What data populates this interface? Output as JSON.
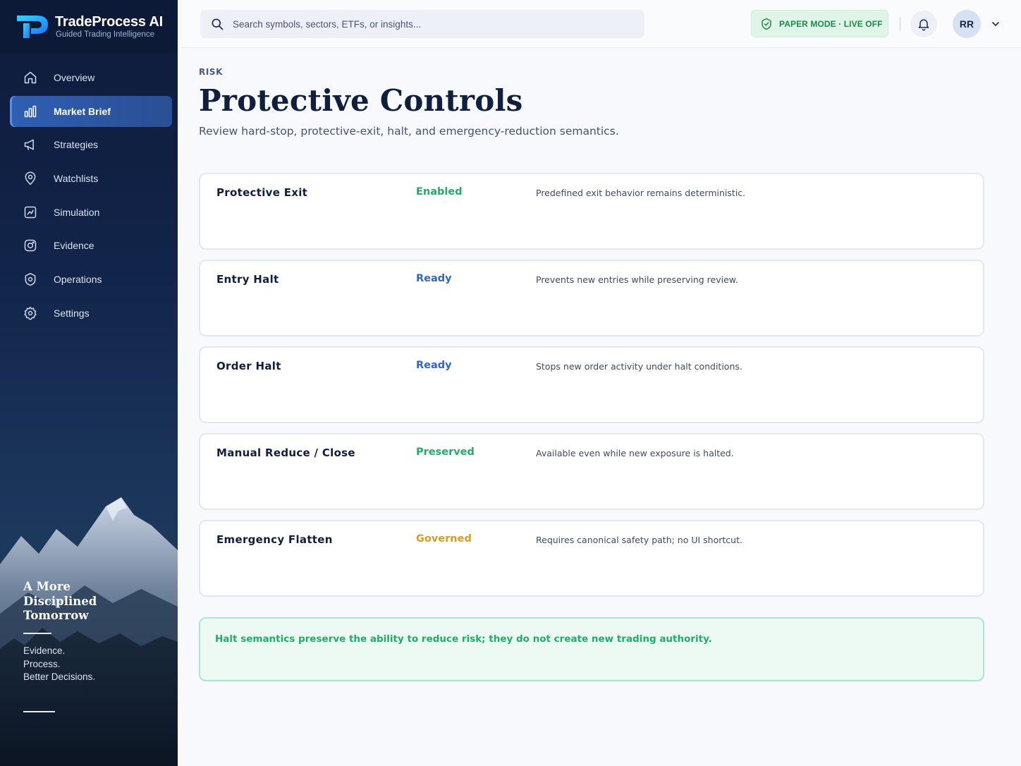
{
  "brand": {
    "name": "TradeProcess AI",
    "tagline": "Guided Trading Intelligence"
  },
  "sidebar": {
    "items": [
      {
        "label": "Overview",
        "icon": "home-icon",
        "active": false
      },
      {
        "label": "Market Brief",
        "icon": "bar-chart-icon",
        "active": true
      },
      {
        "label": "Strategies",
        "icon": "megaphone-icon",
        "active": false
      },
      {
        "label": "Watchlists",
        "icon": "map-pin-icon",
        "active": false
      },
      {
        "label": "Simulation",
        "icon": "chart-box-icon",
        "active": false
      },
      {
        "label": "Evidence",
        "icon": "camera-icon",
        "active": false
      },
      {
        "label": "Operations",
        "icon": "shield-target-icon",
        "active": false
      },
      {
        "label": "Settings",
        "icon": "gear-icon",
        "active": false
      }
    ],
    "motto": {
      "line1": "A More",
      "line2": "Disciplined",
      "line3": "Tomorrow",
      "sub1": "Evidence.",
      "sub2": "Process.",
      "sub3": "Better Decisions."
    }
  },
  "topbar": {
    "search_placeholder": "Search symbols, sectors, ETFs, or insights...",
    "mode_badge": "PAPER MODE · LIVE OFF",
    "avatar_initials": "RR"
  },
  "page": {
    "eyebrow": "RISK",
    "title": "Protective Controls",
    "subtitle": "Review hard-stop, protective-exit, halt, and emergency-reduction semantics."
  },
  "controls": [
    {
      "name": "Protective Exit",
      "status": "Enabled",
      "status_color": "#1eae6a",
      "description": "Predefined exit behavior remains deterministic."
    },
    {
      "name": "Entry Halt",
      "status": "Ready",
      "status_color": "#2f66c9",
      "description": "Prevents new entries while preserving review."
    },
    {
      "name": "Order Halt",
      "status": "Ready",
      "status_color": "#2f66c9",
      "description": "Stops new order activity under halt conditions."
    },
    {
      "name": "Manual Reduce / Close",
      "status": "Preserved",
      "status_color": "#1eae6a",
      "description": "Available even while new exposure is halted."
    },
    {
      "name": "Emergency Flatten",
      "status": "Governed",
      "status_color": "#e29a1c",
      "description": "Requires canonical safety path; no UI shortcut."
    }
  ],
  "notice": {
    "text": "Halt semantics preserve the ability to reduce risk; they do not create new trading authority."
  },
  "colors": {
    "sidebar_bg": "#0e1b3a",
    "accent_blue": "#2f5fb3",
    "success": "#1eae6a",
    "warning": "#e29a1c",
    "ready": "#2f66c9"
  }
}
